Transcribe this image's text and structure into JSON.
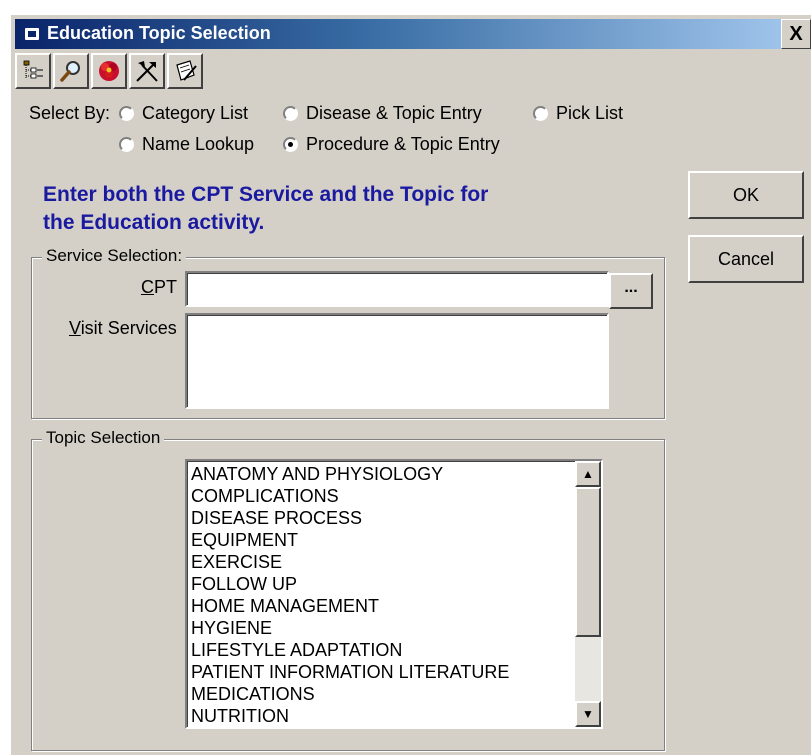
{
  "window": {
    "title": "Education Topic Selection",
    "close_label": "X"
  },
  "toolbar": {
    "buttons": [
      {
        "icon": "tree-list-icon"
      },
      {
        "icon": "magnifier-search-icon"
      },
      {
        "icon": "red-flower-icon"
      },
      {
        "icon": "tools-icon"
      },
      {
        "icon": "notepad-pencil-icon"
      }
    ]
  },
  "select_by": {
    "label": "Select By:",
    "options": [
      {
        "label": "Category List",
        "checked": false
      },
      {
        "label": "Disease & Topic Entry",
        "checked": false
      },
      {
        "label": "Pick List",
        "checked": false
      },
      {
        "label": "Name Lookup",
        "checked": false
      },
      {
        "label": "Procedure & Topic Entry",
        "checked": true
      }
    ]
  },
  "instruction": {
    "line1": "Enter both the CPT Service and the Topic for",
    "line2": "the Education activity."
  },
  "buttons": {
    "ok": "OK",
    "cancel": "Cancel"
  },
  "service_selection": {
    "legend": "Service Selection:",
    "cpt_label_accel": "C",
    "cpt_label_rest": "PT",
    "cpt_value": "",
    "ellipsis": "...",
    "visit_label_accel": "V",
    "visit_label_rest": "isit Services",
    "visit_value": ""
  },
  "topic_selection": {
    "legend": "Topic Selection",
    "items": [
      "ANATOMY AND PHYSIOLOGY",
      "COMPLICATIONS",
      "DISEASE PROCESS",
      "EQUIPMENT",
      "EXERCISE",
      "FOLLOW UP",
      "HOME MANAGEMENT",
      "HYGIENE",
      "LIFESTYLE ADAPTATION",
      "PATIENT INFORMATION LITERATURE",
      "MEDICATIONS",
      "NUTRITION"
    ],
    "scroll_up": "▲",
    "scroll_down": "▼"
  }
}
